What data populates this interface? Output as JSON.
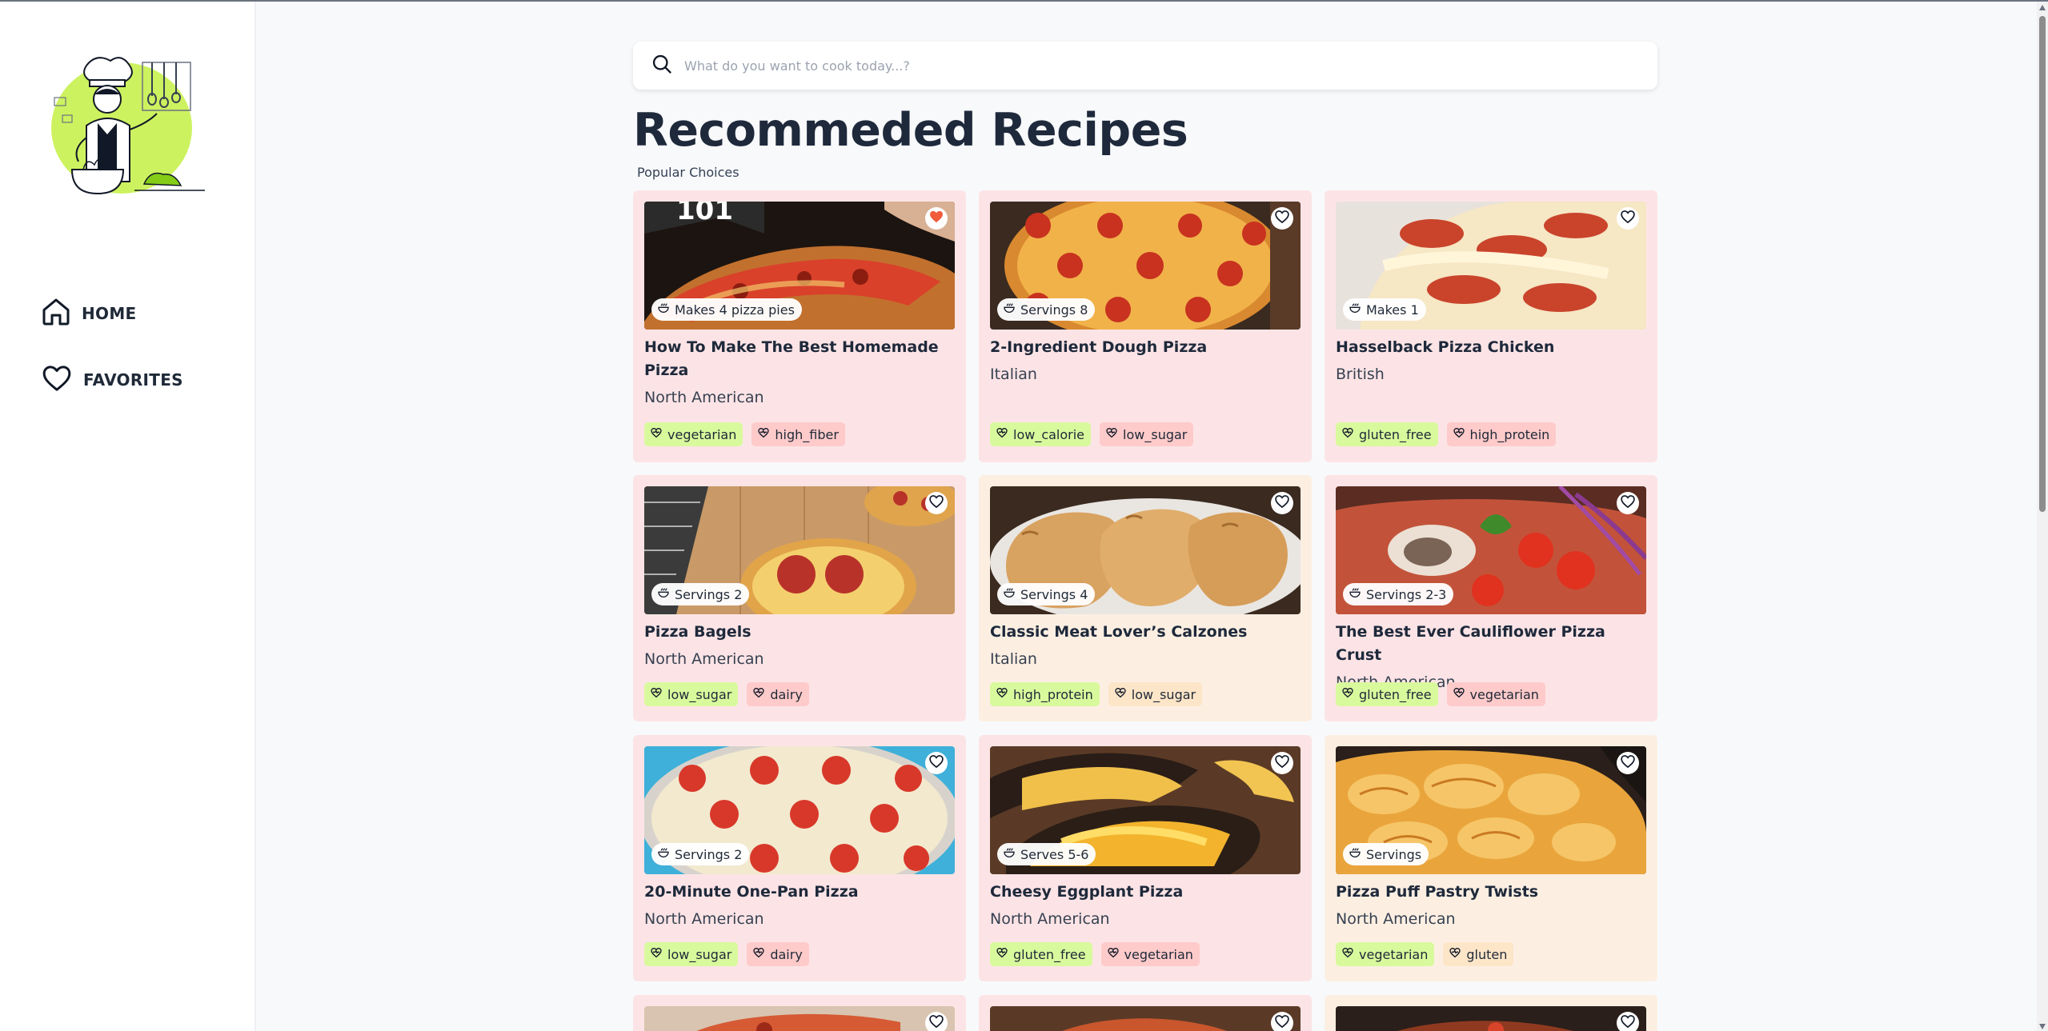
{
  "sidebar": {
    "logo_icon": "chef-cooking-illustration",
    "items": [
      {
        "label": "HOME",
        "icon": "home-icon"
      },
      {
        "label": "FAVORITES",
        "icon": "heart-icon"
      }
    ]
  },
  "search": {
    "placeholder": "What do you want to cook today...?",
    "value": "",
    "icon": "search-icon"
  },
  "header": {
    "title": "Recommeded Recipes",
    "subtitle": "Popular Choices"
  },
  "colors": {
    "card_pink": "#fce4e6",
    "card_peach": "#fcefe2",
    "tag_green": "#d9f99d",
    "tag_red": "#fecaca",
    "tag_orange": "#fde5c8",
    "favorite_active": "#ef5b3b"
  },
  "recipes": [
    {
      "title": "How To Make The Best Homemade Pizza",
      "cuisine": "North American",
      "servings": "Makes 4 pizza pies",
      "favorited": true,
      "tags": [
        "vegetarian",
        "high_fiber"
      ]
    },
    {
      "title": "2-Ingredient Dough Pizza",
      "cuisine": "Italian",
      "servings": "Servings 8",
      "favorited": false,
      "tags": [
        "low_calorie",
        "low_sugar"
      ]
    },
    {
      "title": "Hasselback Pizza Chicken",
      "cuisine": "British",
      "servings": "Makes 1",
      "favorited": false,
      "tags": [
        "gluten_free",
        "high_protein"
      ]
    },
    {
      "title": "Pizza Bagels",
      "cuisine": "North American",
      "servings": "Servings 2",
      "favorited": false,
      "tags": [
        "low_sugar",
        "dairy"
      ]
    },
    {
      "title": "Classic Meat Lover’s Calzones",
      "cuisine": "Italian",
      "servings": "Servings 4",
      "favorited": false,
      "tags": [
        "high_protein",
        "low_sugar"
      ]
    },
    {
      "title": "The Best Ever Cauliflower Pizza Crust",
      "cuisine": "North American",
      "servings": "Servings 2-3",
      "favorited": false,
      "tags": [
        "gluten_free",
        "vegetarian"
      ]
    },
    {
      "title": "20-Minute One-Pan Pizza",
      "cuisine": "North American",
      "servings": "Servings 2",
      "favorited": false,
      "tags": [
        "low_sugar",
        "dairy"
      ]
    },
    {
      "title": "Cheesy Eggplant Pizza",
      "cuisine": "North American",
      "servings": "Serves 5-6",
      "favorited": false,
      "tags": [
        "gluten_free",
        "vegetarian"
      ]
    },
    {
      "title": "Pizza Puff Pastry Twists",
      "cuisine": "North American",
      "servings": "Servings",
      "favorited": false,
      "tags": [
        "vegetarian",
        "gluten"
      ]
    }
  ]
}
